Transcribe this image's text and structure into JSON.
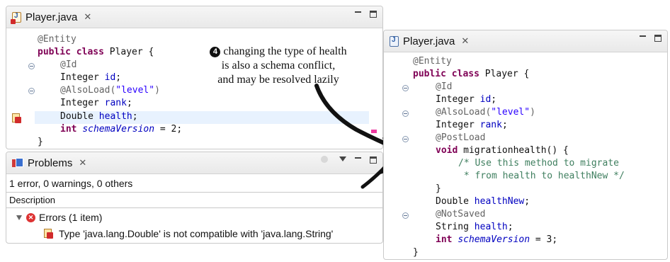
{
  "left_editor": {
    "tab_title": "Player.java",
    "lines": {
      "l1": "@Entity",
      "l2_kw": "public class",
      "l2_rest": " Player {",
      "l3": "@Id",
      "l4_type": "Integer ",
      "l4_field": "id",
      "l4_end": ";",
      "l5_an": "@AlsoLoad(",
      "l5_str": "\"level\"",
      "l5_end": ")",
      "l6_type": "Integer ",
      "l6_field": "rank",
      "l6_end": ";",
      "l7_type": "Double ",
      "l7_field": "health",
      "l7_end": ";",
      "l8_kw": "int ",
      "l8_field": "schemaVersion",
      "l8_end": " = 2;",
      "l9": "}"
    }
  },
  "annotation": {
    "number": "4",
    "line1": "changing the type of health",
    "line2": "is also a schema conflict,",
    "line3": "and may be resolved lazily"
  },
  "problems": {
    "tab_title": "Problems",
    "summary": "1 error, 0 warnings, 0 others",
    "column_header": "Description",
    "group_label": "Errors (1 item)",
    "error_message": "Type 'java.lang.Double' is not compatible with 'java.lang.String'"
  },
  "right_editor": {
    "tab_title": "Player.java",
    "lines": {
      "r1": "@Entity",
      "r2_kw": "public class",
      "r2_rest": " Player {",
      "r3": "@Id",
      "r4_type": "Integer ",
      "r4_field": "id",
      "r4_end": ";",
      "r5_an": "@AlsoLoad(",
      "r5_str": "\"level\"",
      "r5_end": ")",
      "r6_type": "Integer ",
      "r6_field": "rank",
      "r6_end": ";",
      "r7": "@PostLoad",
      "r8_kw": "void ",
      "r8_rest": "migrationhealth() {",
      "r9": "/* Use this method to migrate",
      "r10": " * from health to healthNew */",
      "r11": "}",
      "r12_type": "Double ",
      "r12_field": "healthNew",
      "r12_end": ";",
      "r13": "@NotSaved",
      "r14_type": "String ",
      "r14_field": "health",
      "r14_end": ";",
      "r15_kw": "int ",
      "r15_field": "schemaVersion",
      "r15_end": " = 3;",
      "r16": "}"
    }
  },
  "icons": {
    "close": "close-tab-icon",
    "minimize": "minimize-icon",
    "maximize": "maximize-icon",
    "view_menu": "view-menu-icon",
    "error": "error-icon",
    "java_file": "java-file-icon"
  },
  "colors": {
    "keyword": "#7f0055",
    "annotation": "#646464",
    "string": "#2a00ff",
    "field": "#0000c0",
    "comment": "#3f7f5f",
    "current_line": "#e8f2fe",
    "error_marker": "#ee3aa0"
  }
}
